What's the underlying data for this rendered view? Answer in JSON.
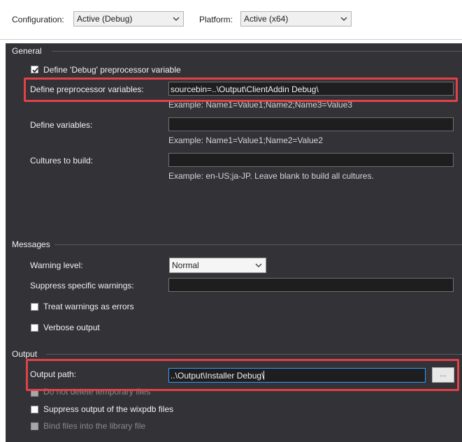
{
  "config_bar": {
    "configuration_label": "Configuration:",
    "configuration_value": "Active (Debug)",
    "platform_label": "Platform:",
    "platform_value": "Active (x64)"
  },
  "general": {
    "header": "General",
    "define_debug_label": "Define 'Debug' preprocessor variable",
    "define_debug_checked": true,
    "preproc_label": "Define preprocessor variables:",
    "preproc_value": "sourcebin=..\\Output\\ClientAddin Debug\\",
    "preproc_example": "Example: Name1=Value1;Name2;Name3=Value3",
    "define_vars_label": "Define variables:",
    "define_vars_value": "",
    "define_vars_example": "Example: Name1=Value1;Name2=Value2",
    "cultures_label": "Cultures to build:",
    "cultures_value": "",
    "cultures_example": "Example: en-US;ja-JP. Leave blank to build all cultures."
  },
  "messages": {
    "header": "Messages",
    "warning_level_label": "Warning level:",
    "warning_level_value": "Normal",
    "suppress_label": "Suppress specific warnings:",
    "suppress_value": "",
    "treat_warnings_label": "Treat warnings as errors",
    "treat_warnings_checked": false,
    "verbose_label": "Verbose output",
    "verbose_checked": false
  },
  "output": {
    "header": "Output",
    "output_path_label": "Output path:",
    "output_path_value": "..\\Output\\Installer Debug\\",
    "browse_label": "...",
    "no_delete_label": "Do not delete temporary files",
    "suppress_wixpdb_label": "Suppress output of the wixpdb files",
    "bind_files_label": "Bind files into the library file"
  },
  "colors": {
    "panel_bg": "#333337",
    "highlight": "#e2404a",
    "focus_border": "#3399ff"
  }
}
